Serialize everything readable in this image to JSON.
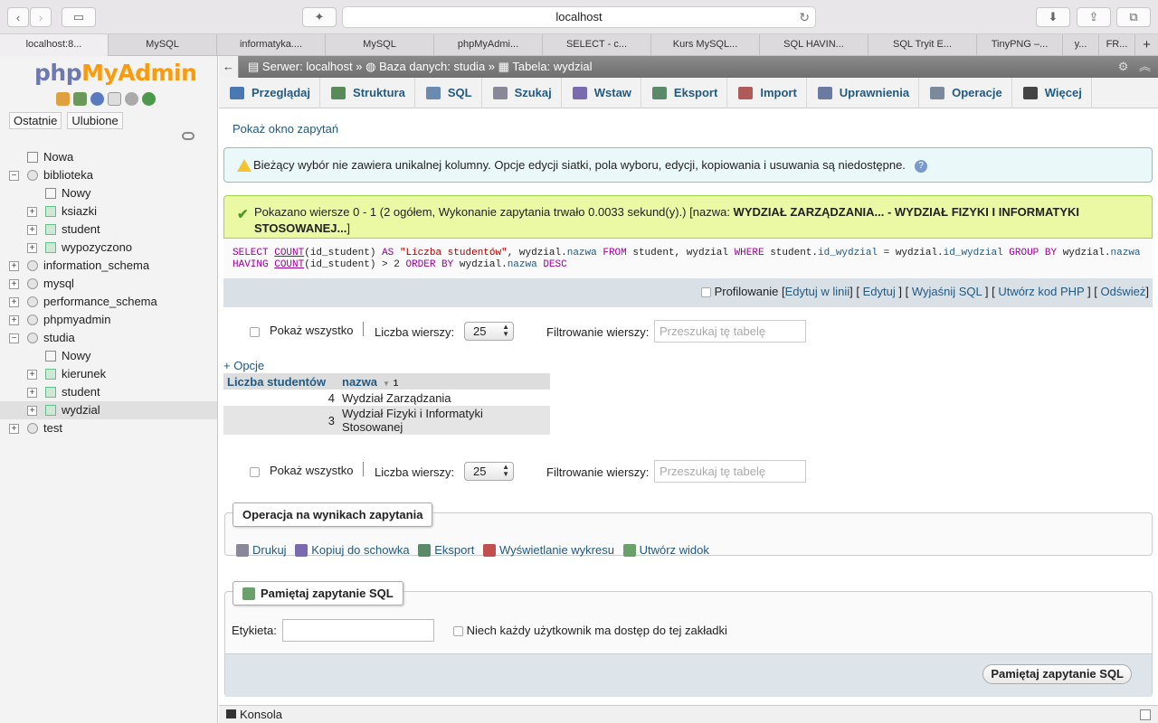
{
  "browser": {
    "url": "localhost",
    "tabs": [
      "localhost:8...",
      "MySQL",
      "informatyka....",
      "MySQL",
      "phpMyAdmi...",
      "SELECT - c...",
      "Kurs MySQL...",
      "SQL HAVIN...",
      "SQL Tryit E...",
      "TinyPNG –...",
      "y...",
      "FR..."
    ],
    "new_tab": "+"
  },
  "sidebar": {
    "logo_php": "php",
    "logo_my": "MyAdmin",
    "recent_label": "Ostatnie",
    "favorites_label": "Ulubione",
    "tree": [
      {
        "label": "Nowa",
        "level": 0,
        "type": "new",
        "expander": ""
      },
      {
        "label": "biblioteka",
        "level": 0,
        "type": "db",
        "expander": "−"
      },
      {
        "label": "Nowy",
        "level": 1,
        "type": "new",
        "expander": ""
      },
      {
        "label": "ksiazki",
        "level": 1,
        "type": "table",
        "expander": "+"
      },
      {
        "label": "student",
        "level": 1,
        "type": "table",
        "expander": "+"
      },
      {
        "label": "wypozyczono",
        "level": 1,
        "type": "table",
        "expander": "+"
      },
      {
        "label": "information_schema",
        "level": 0,
        "type": "db",
        "expander": "+"
      },
      {
        "label": "mysql",
        "level": 0,
        "type": "db",
        "expander": "+"
      },
      {
        "label": "performance_schema",
        "level": 0,
        "type": "db",
        "expander": "+"
      },
      {
        "label": "phpmyadmin",
        "level": 0,
        "type": "db",
        "expander": "+"
      },
      {
        "label": "studia",
        "level": 0,
        "type": "db",
        "expander": "−"
      },
      {
        "label": "Nowy",
        "level": 1,
        "type": "new",
        "expander": ""
      },
      {
        "label": "kierunek",
        "level": 1,
        "type": "table",
        "expander": "+"
      },
      {
        "label": "student",
        "level": 1,
        "type": "table",
        "expander": "+"
      },
      {
        "label": "wydzial",
        "level": 1,
        "type": "table",
        "expander": "+",
        "selected": true
      },
      {
        "label": "test",
        "level": 0,
        "type": "db",
        "expander": "+"
      }
    ]
  },
  "breadcrumb": {
    "server": "Serwer: localhost",
    "sep1": "»",
    "database": "Baza danych: studia",
    "sep2": "»",
    "table": "Tabela: wydzial"
  },
  "menu": [
    {
      "label": "Przeglądaj",
      "icon": "browse-icon",
      "color": "#4a78b0"
    },
    {
      "label": "Struktura",
      "icon": "structure-icon",
      "color": "#5a8a5a"
    },
    {
      "label": "SQL",
      "icon": "sql-icon",
      "color": "#6a8ab0"
    },
    {
      "label": "Szukaj",
      "icon": "search-icon",
      "color": "#889"
    },
    {
      "label": "Wstaw",
      "icon": "insert-icon",
      "color": "#7a6ab0"
    },
    {
      "label": "Eksport",
      "icon": "export-icon",
      "color": "#5a8a6a"
    },
    {
      "label": "Import",
      "icon": "import-icon",
      "color": "#b05a5a"
    },
    {
      "label": "Uprawnienia",
      "icon": "privileges-icon",
      "color": "#6a7aa0"
    },
    {
      "label": "Operacje",
      "icon": "operations-icon",
      "color": "#7a8a9a"
    },
    {
      "label": "Więcej",
      "icon": "more-icon",
      "color": "#444"
    }
  ],
  "show_query_window": "Pokaż okno zapytań",
  "notice": "Bieżący wybór nie zawiera unikalnej kolumny. Opcje edycji siatki, pola wyboru, edycji, kopiowania i usuwania są niedostępne.",
  "success": {
    "text": "Pokazano wiersze 0 - 1 (2 ogółem, Wykonanie zapytania trwało 0.0033 sekund(y).) [nazwa: ",
    "bold": "WYDZIAŁ ZARZĄDZANIA... - WYDZIAŁ FIZYKI I INFORMATYKI STOSOWANEJ...",
    "tail": "]"
  },
  "sql_actions": {
    "profiling": "Profilowanie",
    "edit_inline": "Edytuj w linii",
    "edit": "Edytuj",
    "explain": "Wyjaśnij SQL",
    "create_php": "Utwórz kod PHP",
    "refresh": "Odśwież"
  },
  "nav": {
    "show_all": "Pokaż wszystko",
    "rows_label": "Liczba wierszy:",
    "rows_value": "25",
    "filter_label": "Filtrowanie wierszy:",
    "filter_placeholder": "Przeszukaj tę tabelę"
  },
  "options_link": "+ Opcje",
  "results": {
    "headers": [
      "Liczba studentów",
      "nazwa"
    ],
    "sort_index": "1",
    "rows": [
      [
        "4",
        "Wydział Zarządzania"
      ],
      [
        "3",
        "Wydział Fizyki i Informatyki Stosowanej"
      ]
    ]
  },
  "query_ops": {
    "legend": "Operacja na wynikach zapytania",
    "print": "Drukuj",
    "copy": "Kopiuj do schowka",
    "export": "Eksport",
    "chart": "Wyświetlanie wykresu",
    "create_view": "Utwórz widok"
  },
  "bookmark": {
    "legend": "Pamiętaj zapytanie SQL",
    "label": "Etykieta:",
    "shared": "Niech każdy użytkownik ma dostęp do tej zakładki",
    "submit": "Pamiętaj zapytanie SQL"
  },
  "console": "Konsola"
}
